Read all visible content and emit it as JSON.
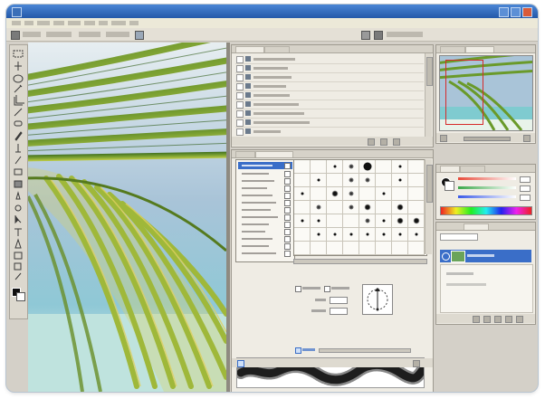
{
  "app": {
    "title": "",
    "accent": "#3a6ec8",
    "titlebar_color": "#2358a8"
  },
  "menubar": {
    "items": [
      "",
      "",
      "",
      "",
      "",
      "",
      "",
      "",
      "",
      ""
    ]
  },
  "optionsbar": {
    "tool_icon": "brush-icon",
    "mode_label": "",
    "opacity_label": ""
  },
  "toolbox": {
    "tools": [
      "marquee-icon",
      "move-icon",
      "lasso-icon",
      "magic-wand-icon",
      "crop-icon",
      "slice-icon",
      "healing-icon",
      "brush-icon",
      "clone-stamp-icon",
      "history-brush-icon",
      "eraser-icon",
      "gradient-icon",
      "blur-icon",
      "dodge-icon",
      "path-select-icon",
      "type-icon",
      "pen-icon",
      "shape-icon",
      "notes-icon",
      "eyedropper-icon",
      "hand-icon",
      "zoom-icon"
    ],
    "foreground_color": "#111111",
    "background_color": "#ffffff"
  },
  "canvas": {
    "image": "palm-frond-over-beach-photo",
    "sky_color": "#a9c4d8",
    "leaf_color": "#7aa032",
    "water_color": "#bfe3de"
  },
  "history_panel": {
    "rows": 10,
    "icon": "history-icon"
  },
  "brushes_panel": {
    "preset_count": 13,
    "selected_index": 0,
    "grid_rows": [
      [
        0,
        0,
        1,
        2,
        4,
        0,
        1,
        0
      ],
      [
        0,
        1,
        0,
        2,
        2,
        0,
        1,
        0
      ],
      [
        1,
        0,
        3,
        2,
        0,
        1,
        0,
        0
      ],
      [
        0,
        2,
        0,
        2,
        3,
        0,
        3,
        0
      ],
      [
        1,
        1,
        0,
        0,
        2,
        1,
        3,
        3
      ],
      [
        0,
        1,
        1,
        1,
        1,
        1,
        1,
        1
      ],
      [
        0,
        0,
        0,
        0,
        0,
        0,
        0,
        0
      ]
    ],
    "brush_tip_icon": "brush-tip-icon",
    "angle_icon": "angle-roundness-icon"
  },
  "navigator_panel": {
    "thumbnail": "palm-frond-thumbnail"
  },
  "color_panel": {
    "sliders": [
      {
        "from": "#e84a3a",
        "to": "#ffffff"
      },
      {
        "from": "#3aa84a",
        "to": "#ffffff"
      },
      {
        "from": "#3a5ae8",
        "to": "#ffffff"
      }
    ],
    "swatch_strip": "color-ramp"
  },
  "layers_panel": {
    "selected_layer_color": "#3a6ec8",
    "eye_icon": "eye-icon"
  }
}
